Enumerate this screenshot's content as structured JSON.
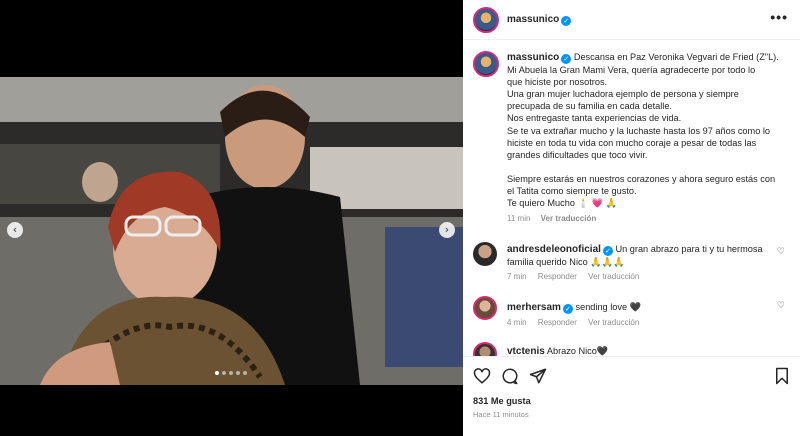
{
  "post": {
    "username": "massunico",
    "verified_mark": "✓",
    "more_label": "•••",
    "caption_lines": [
      "Descansa en Paz Veronika Vegvari de Fried (Z\"L).",
      "Mi Abuela la Gran Mami Vera, quería agradecerte por todo lo",
      "que hiciste por nosotros.",
      "Una gran mujer luchadora ejemplo de persona y siempre",
      "precupada de su familia en cada detalle.",
      "Nos entregaste tanta experiencias de vida.",
      "Se te va extrañar mucho y la luchaste hasta los 97 años como lo",
      "hiciste en toda tu vida con mucho coraje a pesar de todas las",
      "grandes dificultades que toco vivir.",
      "",
      "Siempre estarás en nuestros corazones y ahora seguro estás con",
      "el Tatita como siempre te gusto.",
      "Te quiero Mucho 🕯️ 💗 🙏"
    ],
    "caption_time": "11 min",
    "caption_translate": "Ver traducción",
    "likes": "831 Me gusta",
    "posted": "Hace 11 minutos"
  },
  "media": {
    "prev_label": "‹",
    "next_label": "›",
    "dots": 5,
    "active_dot": 0
  },
  "comments": [
    {
      "username": "andresdeleonoficial",
      "text": "Un gran abrazo para ti y tu hermosa familia querido Nico 🙏🙏🙏",
      "time": "7 min",
      "reply": "Responder",
      "translate": "Ver traducción"
    },
    {
      "username": "merhersam",
      "text": "sending love 🖤",
      "time": "4 min",
      "reply": "Responder",
      "translate": "Ver traducción"
    },
    {
      "username": "vtctenis",
      "text": "Abrazo Nico🖤"
    }
  ],
  "icons": {
    "like": "heart-icon",
    "comment": "comment-icon",
    "share": "share-icon",
    "save": "bookmark-icon"
  },
  "colors": {
    "verified": "#0095f6",
    "muted": "#8e8e8e",
    "text": "#262626"
  }
}
